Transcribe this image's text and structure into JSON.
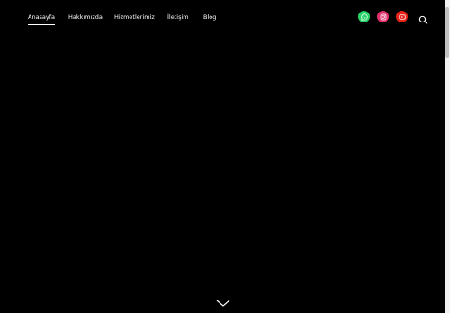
{
  "nav": {
    "items": [
      {
        "label": "Anasayfa",
        "active": true
      },
      {
        "label": "Hakkımızda",
        "active": false
      },
      {
        "label": "Hizmetlerimiz",
        "active": false
      },
      {
        "label": "İletişim",
        "active": false
      },
      {
        "label": "Blog",
        "active": false
      }
    ]
  },
  "social": {
    "whatsapp": {
      "icon": "whatsapp-icon",
      "color": "#25d366"
    },
    "instagram": {
      "icon": "instagram-icon",
      "color": "#e1306c"
    },
    "youtube": {
      "icon": "youtube-icon",
      "color": "#e62117"
    }
  },
  "search": {
    "icon": "search-icon"
  },
  "hero": {
    "scroll_icon": "chevron-down-icon",
    "background": "#000000"
  },
  "scrollbar": {
    "position": 0
  }
}
